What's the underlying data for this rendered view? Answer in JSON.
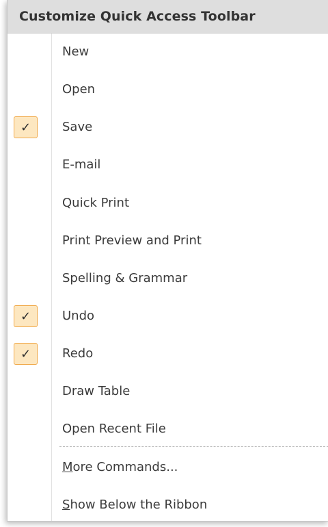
{
  "menu": {
    "title": "Customize Quick Access Toolbar",
    "items": [
      {
        "label": "New",
        "checked": false
      },
      {
        "label": "Open",
        "checked": false
      },
      {
        "label": "Save",
        "checked": true
      },
      {
        "label": "E-mail",
        "checked": false
      },
      {
        "label": "Quick Print",
        "checked": false
      },
      {
        "label": "Print Preview and Print",
        "checked": false
      },
      {
        "label": "Spelling & Grammar",
        "checked": false
      },
      {
        "label": "Undo",
        "checked": true
      },
      {
        "label": "Redo",
        "checked": true
      },
      {
        "label": "Draw Table",
        "checked": false
      },
      {
        "label": "Open Recent File",
        "checked": false
      }
    ],
    "more_commands": "More Commands...",
    "show_below": "Show Below the Ribbon",
    "check_glyph": "✓"
  },
  "colors": {
    "header_bg": "#dedede",
    "check_bg": "#fde7c0",
    "check_border": "#f0a94a"
  }
}
